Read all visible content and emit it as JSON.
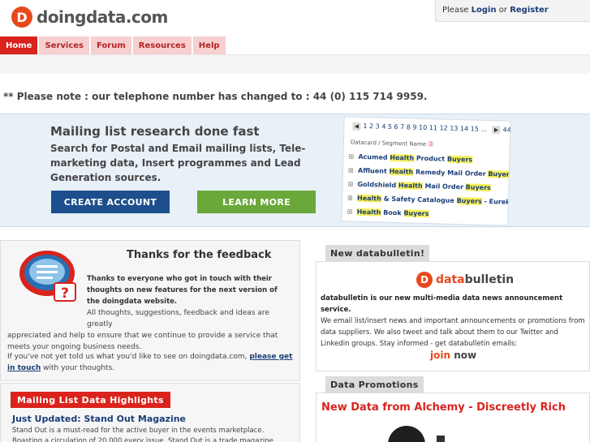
{
  "header": {
    "logo_letter": "D",
    "logo_text": "doingdata.com",
    "login_prefix": "Please",
    "login_label": "Login",
    "login_or": "or",
    "register_label": "Register"
  },
  "nav": {
    "items": [
      {
        "label": "Home",
        "active": true
      },
      {
        "label": "Services"
      },
      {
        "label": "Forum"
      },
      {
        "label": "Resources"
      },
      {
        "label": "Help"
      }
    ]
  },
  "notice": "** Please note : our telephone number has changed to : 44 (0) 115 714 9959.",
  "hero": {
    "title": "Mailing list research done fast",
    "subtitle": "Search for Postal and Email mailing lists, Tele-marketing data, Insert programmes and Lead Generation sources.",
    "create_button": "CREATE ACCOUNT",
    "learn_button": "LEARN MORE",
    "preview": {
      "pager": "1 2 3 4 5 6 7 8 9 10 11 12 13 14 15 ...",
      "pager_end": "44",
      "column_header": "Datacard / Segment Name",
      "rows": [
        {
          "a": "Acumed ",
          "h": "Health",
          "b": " Product ",
          "h2": "Buyers",
          "c": ""
        },
        {
          "a": "Affluent ",
          "h": "Health",
          "b": " Remedy Mail Order ",
          "h2": "Buyers",
          "c": ""
        },
        {
          "a": "Goldshield ",
          "h": "Health",
          "b": " Mail Order ",
          "h2": "Buyers",
          "c": ""
        },
        {
          "a": "",
          "h": "Health",
          "b": " & Safety Catalogue ",
          "h2": "Buyers",
          "c": " - Eureka!"
        },
        {
          "a": "",
          "h": "Health",
          "b": " Book ",
          "h2": "Buyers",
          "c": ""
        }
      ]
    }
  },
  "feedback": {
    "title": "Thanks for the feedback",
    "intro": "Thanks to everyone who got in touch with their thoughts on new features for the next version of the doingdata website.",
    "body_1": "All thoughts, suggestions, feedback and ideas are greatly",
    "body_2": "appreciated and help to ensure that we continue to provide a service that meets your ongoing business needs.",
    "foot_prefix": "If you've not yet told us what you'd like to see on doingdata.com,",
    "foot_link": "please get in touch",
    "foot_suffix": "with your thoughts."
  },
  "highlights": {
    "tab": "Mailing List Data Highlights",
    "title": "Just Updated: Stand Out Magazine",
    "text": "Stand Out is a must-read for the active buyer in the events marketplace. Boasting a circulation of 20,000 every issue, Stand Out is a trade magazine providing organisers,"
  },
  "databulletin": {
    "tab": "New databulletin!",
    "logo_prefix": "data",
    "logo_suffix": "bulletin",
    "lead": "databulletin is our new multi-media data news announcement service.",
    "text": "We email list/insert news and important announcements or promotions from data suppliers. We also tweet and talk about them to our Twitter and Linkedin groups.  Stay informed - get databulletin emails:",
    "join_a": "join",
    "join_b": "now"
  },
  "promotions": {
    "tab": "Data Promotions",
    "title": "New Data from Alchemy - Discreetly Rich"
  }
}
